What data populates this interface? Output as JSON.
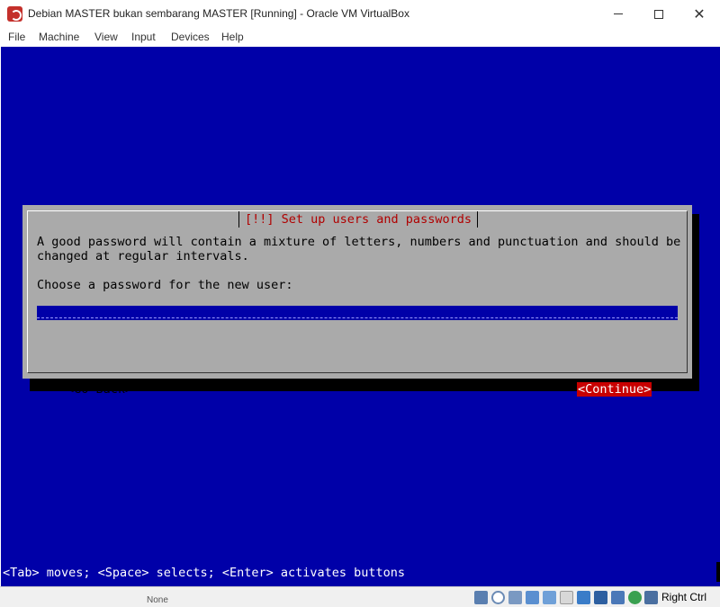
{
  "window": {
    "title": "Debian MASTER bukan sembarang MASTER [Running] - Oracle VM VirtualBox",
    "icon": "virtualbox-app-icon"
  },
  "menu": {
    "items": [
      "File",
      "Machine",
      "View",
      "Input",
      "Devices",
      "Help"
    ]
  },
  "installer": {
    "dialog_title": "[!!] Set up users and passwords",
    "message_line1": "A good password will contain a mixture of letters, numbers and punctuation and should be",
    "message_line2": "changed at regular intervals.",
    "prompt": "Choose a password for the new user:",
    "password_value": "*********",
    "go_back_label": "<Go Back>",
    "continue_label": "<Continue>",
    "help_line": "<Tab> moves; <Space> selects; <Enter> activates buttons",
    "colors": {
      "background": "#0000a8",
      "dialog": "#aaaaaa",
      "title": "#b00000",
      "selected_button": "#c80000"
    }
  },
  "statusbar": {
    "left_text": "None",
    "host_key": "Right Ctrl",
    "icons": [
      "hard-disk-icon",
      "optical-drive-icon",
      "audio-icon",
      "network-icon",
      "usb-icon",
      "shared-folders-icon",
      "display-icon",
      "video-capture-icon",
      "cpu-icon",
      "mouse-integration-icon",
      "keyboard-capture-icon"
    ]
  }
}
